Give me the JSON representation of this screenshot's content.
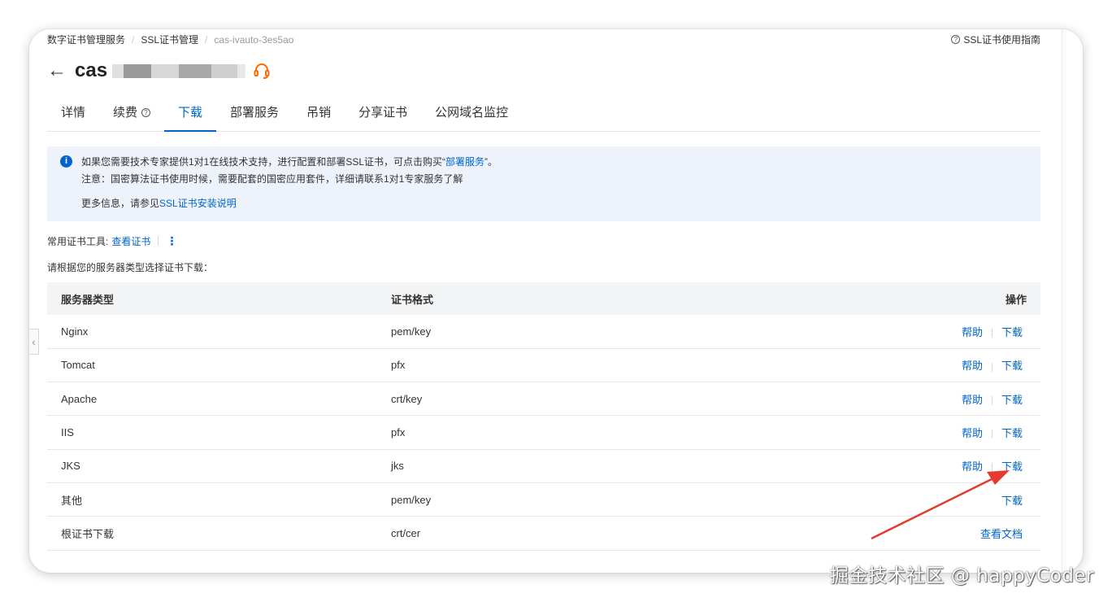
{
  "breadcrumb": {
    "items": [
      "数字证书管理服务",
      "SSL证书管理",
      "cas-ivauto-3es5ao"
    ],
    "separator": "/"
  },
  "guide": {
    "label": "SSL证书使用指南"
  },
  "header": {
    "title_prefix": "cas"
  },
  "tabs": [
    {
      "label": "详情"
    },
    {
      "label": "续费"
    },
    {
      "label": "下载",
      "active": true
    },
    {
      "label": "部署服务"
    },
    {
      "label": "吊销"
    },
    {
      "label": "分享证书"
    },
    {
      "label": "公网域名监控"
    }
  ],
  "notice": {
    "line1_prefix": "如果您需要技术专家提供1对1在线技术支持，进行配置和部署SSL证书，可点击购买“",
    "line1_link": "部署服务",
    "line1_suffix": "”。",
    "line2": "注意：国密算法证书使用时候，需要配套的国密应用套件，详细请联系1对1专家服务了解",
    "line3_prefix": "更多信息，请参见",
    "line3_link": "SSL证书安装说明"
  },
  "tools": {
    "label": "常用证书工具:",
    "link": "查看证书",
    "more": "⋮"
  },
  "prompt": "请根据您的服务器类型选择证书下载：",
  "table": {
    "headers": [
      "服务器类型",
      "证书格式",
      "操作"
    ],
    "rows": [
      {
        "server": "Nginx",
        "format": "pem/key",
        "help": "帮助",
        "action": "下载"
      },
      {
        "server": "Tomcat",
        "format": "pfx",
        "help": "帮助",
        "action": "下载"
      },
      {
        "server": "Apache",
        "format": "crt/key",
        "help": "帮助",
        "action": "下载"
      },
      {
        "server": "IIS",
        "format": "pfx",
        "help": "帮助",
        "action": "下载"
      },
      {
        "server": "JKS",
        "format": "jks",
        "help": "帮助",
        "action": "下载"
      },
      {
        "server": "其他",
        "format": "pem/key",
        "help": "",
        "action": "下载"
      },
      {
        "server": "根证书下载",
        "format": "crt/cer",
        "help": "",
        "action": "查看文档"
      }
    ]
  },
  "watermark": "掘金技术社区 @ happyCoder",
  "colors": {
    "accent": "#0064c8",
    "headset": "#ff6a00",
    "arrow": "#e53a2f",
    "notice_bg": "#eef3fb"
  }
}
